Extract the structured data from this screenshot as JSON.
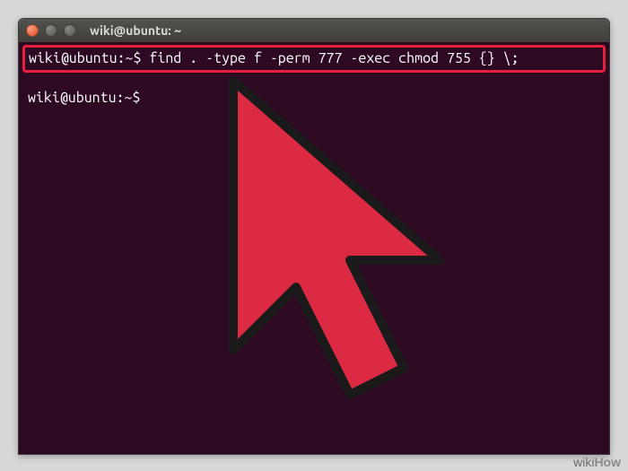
{
  "titlebar": {
    "title": "wiki@ubuntu: ~"
  },
  "terminal": {
    "prompt": "wiki@ubuntu:~$",
    "command": "find . -type f -perm 777 -exec chmod 755 {} \\;",
    "second_prompt": "wiki@ubuntu:~$"
  },
  "watermark": {
    "brand_a": "wiki",
    "brand_b": "How"
  }
}
